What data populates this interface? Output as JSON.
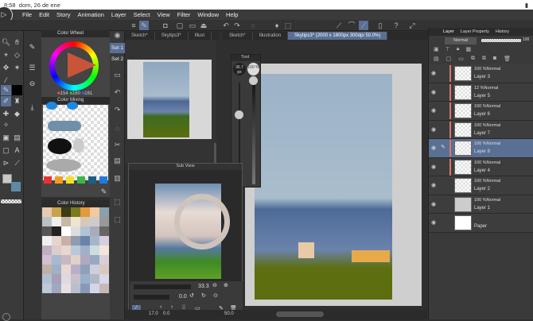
{
  "status": {
    "time": "8:58",
    "date": "dom, 26 de ene"
  },
  "menu": [
    "File",
    "Edit",
    "Story",
    "Animation",
    "Layer",
    "Select",
    "View",
    "Filter",
    "Window",
    "Help"
  ],
  "colors": {
    "accent": "#5a6f94",
    "panel": "#3a3a3a",
    "layer_marker": "#d9776a"
  },
  "color_wheel": {
    "title": "Color Wheel",
    "r": "154",
    "g": "160",
    "b": "161"
  },
  "color_mixing": {
    "title": "Color Mixing"
  },
  "color_history": {
    "title": "Color History"
  },
  "palette": [
    "#e8322e",
    "#f29b23",
    "#f2df2c",
    "#3bb84a",
    "#1f5e80",
    "#1e7ce0"
  ],
  "sets": [
    "Set 1",
    "Set 2"
  ],
  "left_tabs": [
    "Sketch*",
    "Skytips3*",
    "Illust"
  ],
  "main_tabs": [
    "Sketch*",
    "Illustration",
    "Skytips3* (2000 x 1800px 300dpi 50.0%)"
  ],
  "tool_window": {
    "title": "Tool",
    "size": "36.7 px",
    "opacity": "100 %"
  },
  "subview": {
    "title": "Sub View",
    "zoom": "33.3",
    "angle": "0.0"
  },
  "bottom": {
    "v1": "17.0",
    "v2": "0.0",
    "v3": "50.0"
  },
  "layer_panel": {
    "tabs": [
      "Layer",
      "Layer Property",
      "History"
    ],
    "blend": "Normal",
    "opacity": "100",
    "layers": [
      {
        "mode": "100 %Normal",
        "name": "Layer 3"
      },
      {
        "mode": "12 %Normal",
        "name": "Layer 5"
      },
      {
        "mode": "100 %Normal",
        "name": "Layer 6"
      },
      {
        "mode": "100 %Normal",
        "name": "Layer 7"
      },
      {
        "mode": "100 %Normal",
        "name": "Layer 8"
      },
      {
        "mode": "100 %Normal",
        "name": "Layer 4"
      },
      {
        "mode": "100 %Normal",
        "name": "Layer 2"
      },
      {
        "mode": "100 %Normal",
        "name": "Layer 1"
      },
      {
        "mode": "",
        "name": "Paper"
      }
    ]
  }
}
